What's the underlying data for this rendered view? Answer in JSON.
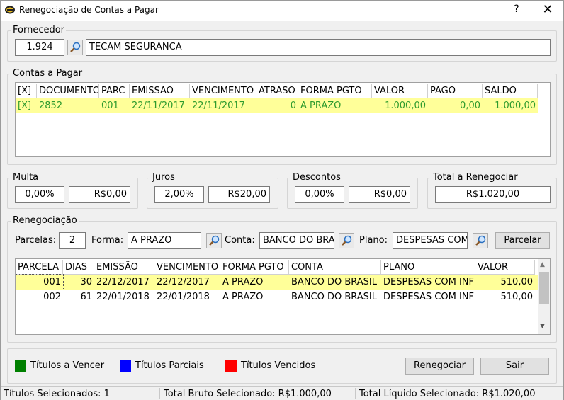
{
  "window": {
    "title": "Renegociação de Contas a Pagar",
    "help_glyph": "?",
    "close_glyph": "✕"
  },
  "fornecedor": {
    "legend": "Fornecedor",
    "code": "1.924",
    "name": "TECAM SEGURANCA"
  },
  "contas": {
    "legend": "Contas a Pagar",
    "headers": [
      "[X]",
      "DOCUMENTO",
      "PARC",
      "EMISSAO",
      "VENCIMENTO",
      "ATRASO",
      "FORMA PGTO",
      "VALOR",
      "PAGO",
      "SALDO"
    ],
    "rows": [
      [
        "[X]",
        "2852",
        "001",
        "22/11/2017",
        "22/11/2017",
        "0",
        "A PRAZO",
        "1.000,00",
        "0,00",
        "1.000,00"
      ]
    ],
    "row_text_color": "#2e9b2e",
    "row_bg": "#ffff99"
  },
  "multa": {
    "legend": "Multa",
    "percent": "0,00%",
    "value": "R$0,00"
  },
  "juros": {
    "legend": "Juros",
    "percent": "2,00%",
    "value": "R$20,00"
  },
  "descontos": {
    "legend": "Descontos",
    "percent": "0,00%",
    "value": "R$0,00"
  },
  "total": {
    "legend": "Total a Renegociar",
    "value": "R$1.020,00"
  },
  "reneg": {
    "legend": "Renegociação",
    "parcelas_label": "Parcelas:",
    "parcelas_value": "2",
    "forma_label": "Forma:",
    "forma_value": "A PRAZO",
    "conta_label": "Conta:",
    "conta_value": "BANCO DO BRA",
    "plano_label": "Plano:",
    "plano_value": "DESPESAS COM",
    "parcelar_button": "Parcelar",
    "headers": [
      "PARCELA",
      "DIAS",
      "EMISSÃO",
      "VENCIMENTO",
      "FORMA PGTO",
      "CONTA",
      "PLANO",
      "VALOR"
    ],
    "rows": [
      [
        "001",
        "30",
        "22/12/2017",
        "22/12/2017",
        "A PRAZO",
        "BANCO DO BRASIL",
        "DESPESAS COM INF",
        "510,00"
      ],
      [
        "002",
        "61",
        "22/01/2018",
        "22/01/2018",
        "A PRAZO",
        "BANCO DO BRASIL",
        "DESPESAS COM INF",
        "510,00"
      ]
    ],
    "selected_bg": "#ffff99"
  },
  "legend_items": [
    {
      "label": "Títulos a Vencer",
      "color": "#008000"
    },
    {
      "label": "Títulos Parciais",
      "color": "#0000ff"
    },
    {
      "label": "Títulos Vencidos",
      "color": "#ff0000"
    }
  ],
  "buttons": {
    "renegociar": "Renegociar",
    "sair": "Sair"
  },
  "status": {
    "selecionados": "Títulos Selecionados: 1",
    "bruto": "Total Bruto Selecionado: R$1.000,00",
    "liquido": "Total Líquido Selecionado: R$1.020,00"
  },
  "icons": {
    "app": "app-logo-icon",
    "lookup": "magnifier-icon",
    "scroll_down": "chevron-down-icon",
    "scroll_up": "chevron-up-icon"
  }
}
